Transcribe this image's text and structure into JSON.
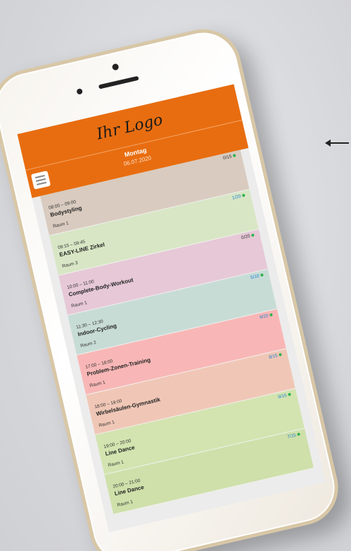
{
  "header": {
    "logo_text": "Ihr Logo"
  },
  "nav": {
    "day": "Montag",
    "date": "06.07.2020"
  },
  "courses": [
    {
      "time": "08:00 – 09:00",
      "name": "Bodystyling",
      "room": "Raum 1",
      "count": "0/15",
      "color": "#d9cbbf",
      "count_color": "#333333"
    },
    {
      "time": "09:15 – 09:45",
      "name": "EASY-LINE Zirkel",
      "room": "Raum 3",
      "count": "1/20",
      "color": "#d8e6c5",
      "count_color": "#1a7fd4"
    },
    {
      "time": "10:00 – 11:00",
      "name": "Complete-Body-Workout",
      "room": "Raum 1",
      "count": "0/20",
      "color": "#e6c8d6",
      "count_color": "#333333"
    },
    {
      "time": "11:30 – 12:30",
      "name": "Indoor-Cycling",
      "room": "Raum 2",
      "count": "5/10",
      "color": "#c8dcd6",
      "count_color": "#1a7fd4"
    },
    {
      "time": "17:00 – 18:00",
      "name": "Problem-Zonen-Training",
      "room": "Raum 1",
      "count": "9/20",
      "color": "#f8b7b6",
      "count_color": "#1a7fd4"
    },
    {
      "time": "18:00 – 19:00",
      "name": "Wirbelsäulen-Gymnastik",
      "room": "Raum 1",
      "count": "8/15",
      "color": "#f0c7b6",
      "count_color": "#1a7fd4"
    },
    {
      "time": "19:00 – 20:00",
      "name": "Line Dance",
      "room": "Raum 1",
      "count": "9/15",
      "color": "#d3e4b0",
      "count_color": "#1a7fd4"
    },
    {
      "time": "20:00 – 21:00",
      "name": "Line Dance",
      "room": "Raum 1",
      "count": "7/15",
      "color": "#cfe0aa",
      "count_color": "#1a7fd4"
    }
  ]
}
